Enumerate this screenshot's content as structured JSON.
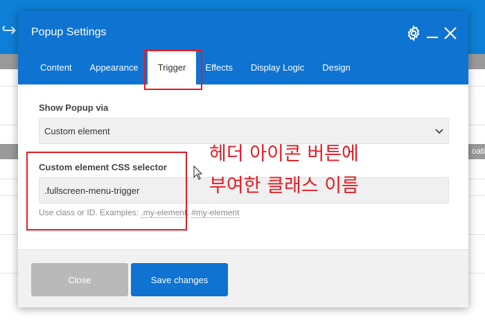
{
  "modal": {
    "title": "Popup Settings",
    "icons": [
      "gear-icon",
      "minimize-icon",
      "close-icon"
    ],
    "tabs": [
      {
        "label": "Content",
        "active": false
      },
      {
        "label": "Appearance",
        "active": false
      },
      {
        "label": "Trigger",
        "active": true
      },
      {
        "label": "Effects",
        "active": false
      },
      {
        "label": "Display Logic",
        "active": false
      },
      {
        "label": "Design",
        "active": false
      }
    ],
    "show_popup_via": {
      "label": "Show Popup via",
      "value": "Custom element"
    },
    "css_selector": {
      "label": "Custom element CSS selector",
      "value": ".fullscreen-menu-trigger",
      "help_prefix": "Use class or ID. Examples: ",
      "example_class": ".my-element",
      "example_sep": ", ",
      "example_id": "#my-element"
    },
    "footer": {
      "close_label": "Close",
      "save_label": "Save changes"
    }
  },
  "annotation": {
    "line1": "헤더 아이콘 버튼에",
    "line2": "부여한 클래스 이름",
    "color": "#e31b23"
  },
  "background": {
    "right_label": "oati"
  },
  "colors": {
    "header_blue": "#0e73d1",
    "close_grey": "#b9b9b9"
  }
}
